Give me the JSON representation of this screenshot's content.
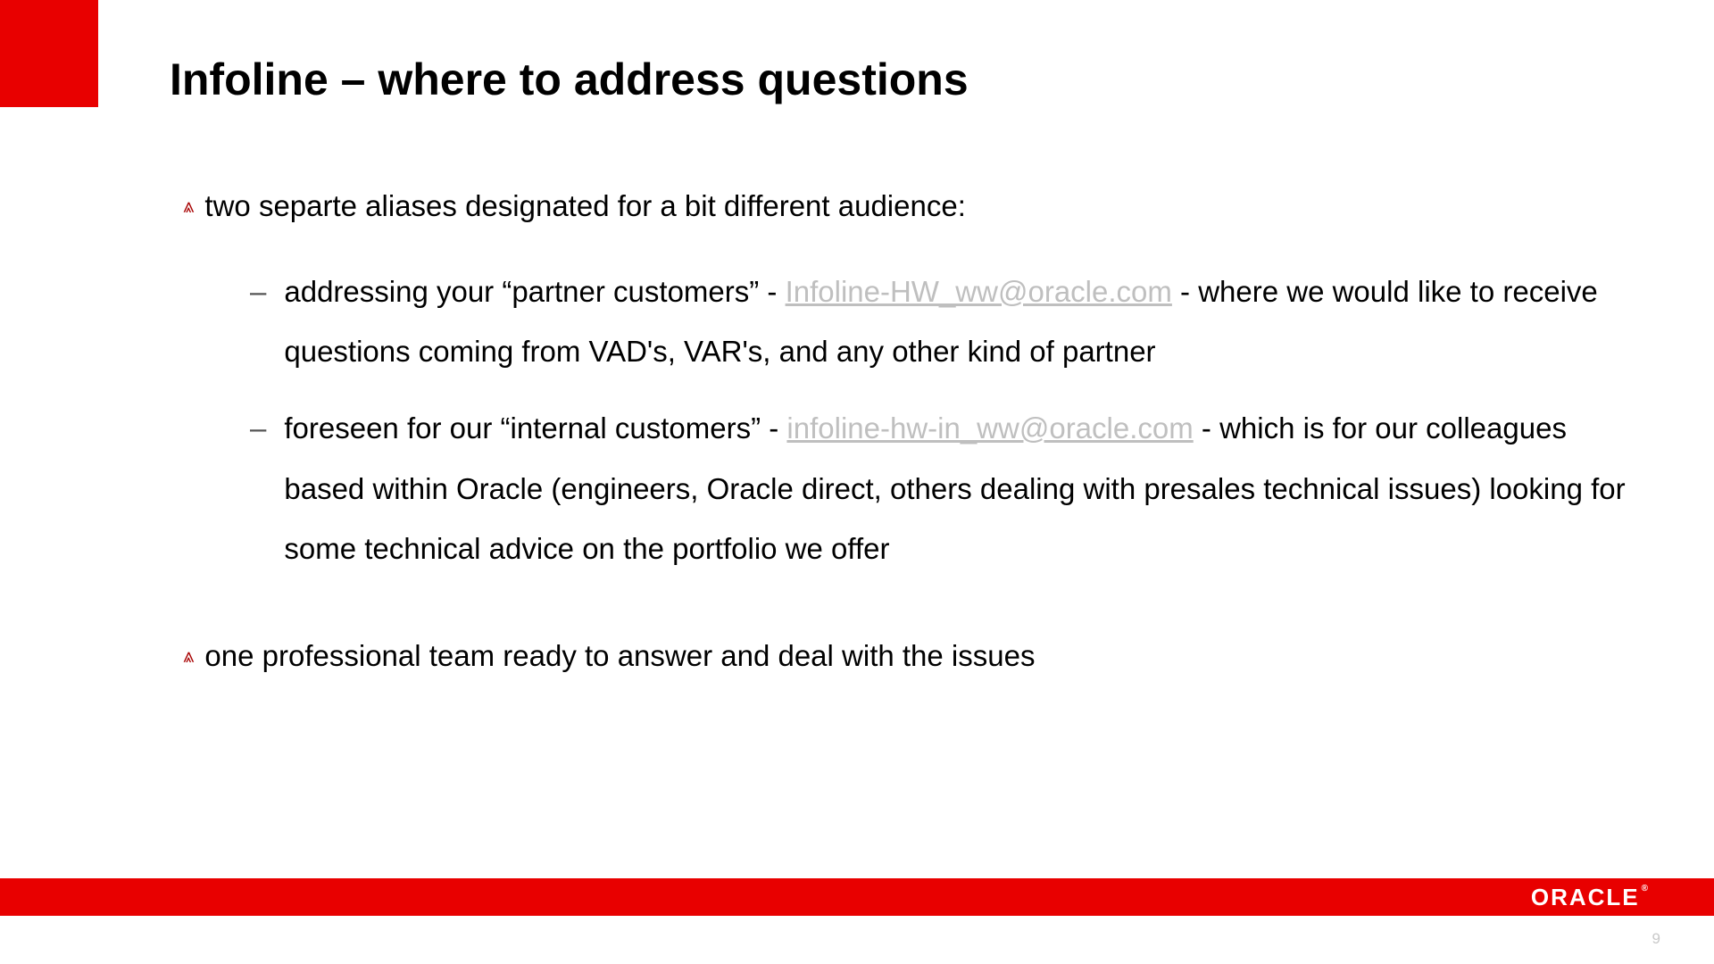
{
  "title": "Infoline – where to address questions",
  "colors": {
    "brand_red": "#e80000",
    "bullet_red": "#a80000",
    "link_gray": "#bfbfbf"
  },
  "bullets": {
    "first": "two separte aliases designated for a bit different audience:",
    "sub": [
      {
        "pre": "addressing your “partner customers” -  ",
        "link": "Infoline-HW_ww@oracle.com",
        "post": " - where we would like to receive questions coming from VAD's, VAR's, and any other kind of partner"
      },
      {
        "pre": "foreseen for our “internal customers” -  ",
        "link": "infoline-hw-in_ww@oracle.com",
        "post": " - which is for our colleagues based within Oracle (engineers, Oracle direct, others dealing with presales technical issues) looking for some technical advice on the portfolio we offer"
      }
    ],
    "second": "one professional team ready to answer and deal with the issues"
  },
  "footer": {
    "logo": "ORACLE",
    "registered": "®"
  },
  "page_number": "9",
  "glyphs": {
    "triangle": "⩓",
    "dash": "–"
  }
}
